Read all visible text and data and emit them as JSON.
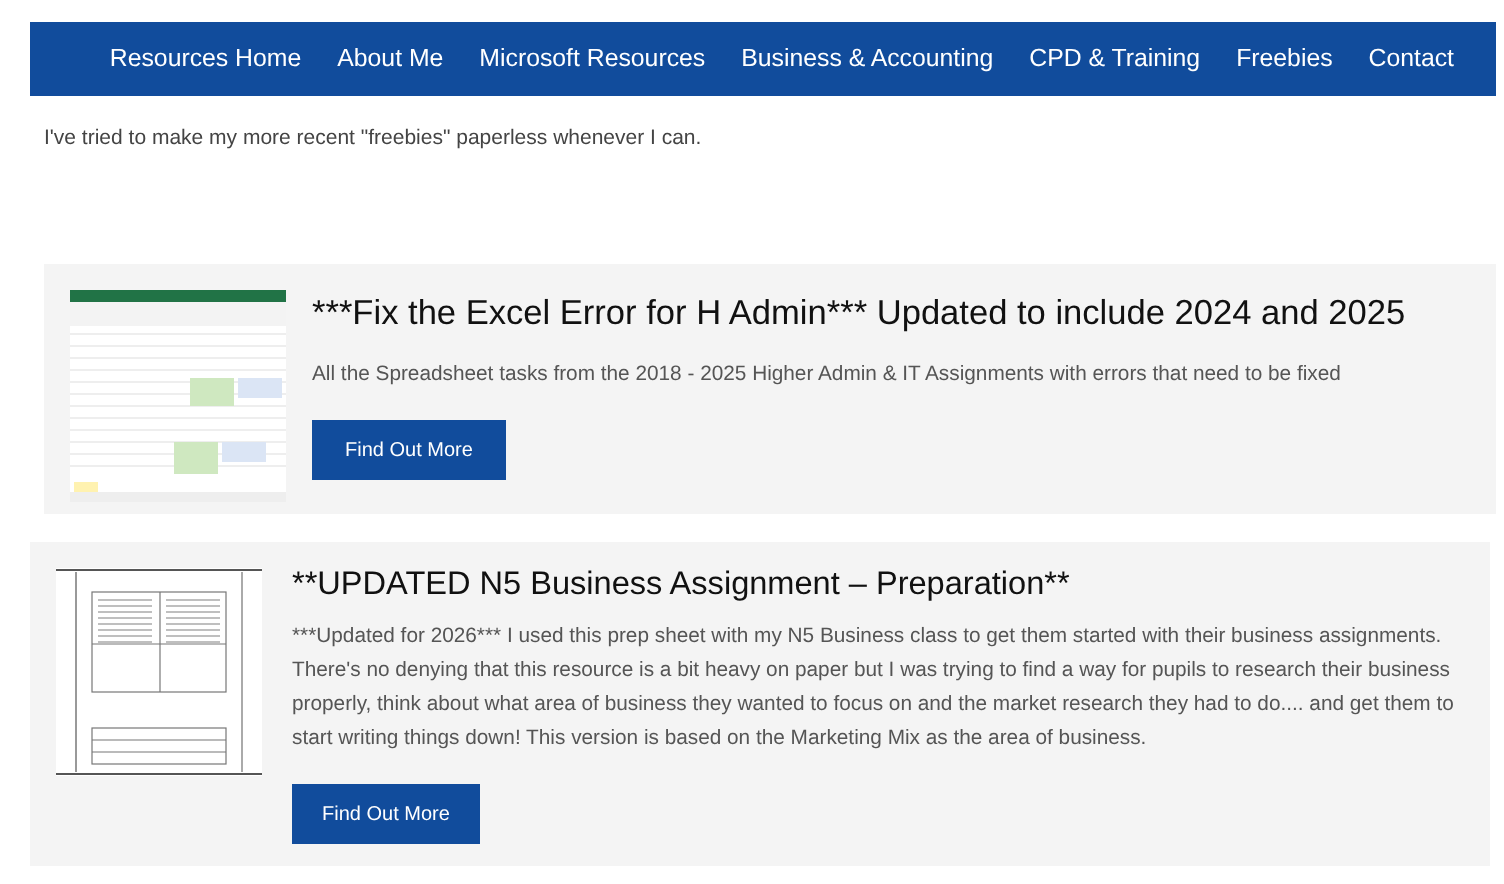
{
  "nav": {
    "items": [
      {
        "label": "Resources Home"
      },
      {
        "label": "About Me"
      },
      {
        "label": "Microsoft Resources"
      },
      {
        "label": "Business & Accounting"
      },
      {
        "label": "CPD & Training"
      },
      {
        "label": "Freebies"
      },
      {
        "label": "Contact"
      }
    ]
  },
  "intro": "I've tried to make my more recent \"freebies\" paperless whenever I can.",
  "resources": [
    {
      "kind": "spreadsheet",
      "title": "***Fix the Excel Error for H Admin*** Updated to include 2024 and 2025",
      "description": "All the Spreadsheet tasks from the 2018 - 2025 Higher Admin & IT Assignments with errors that need to be fixed",
      "button": "Find Out More"
    },
    {
      "kind": "document",
      "title": "**UPDATED N5 Business Assignment – Preparation**",
      "description": "***Updated for 2026*** I used this prep sheet with my N5 Business class to get them started with their business assignments.  There's no denying that this resource is a bit heavy on paper but I was trying to find a way for pupils to research their business properly, think about what area of business they wanted to focus on and the market research they had to do.... and get them to start writing things down! This version is based on the Marketing Mix as the area of business.",
      "button": "Find Out More"
    }
  ]
}
